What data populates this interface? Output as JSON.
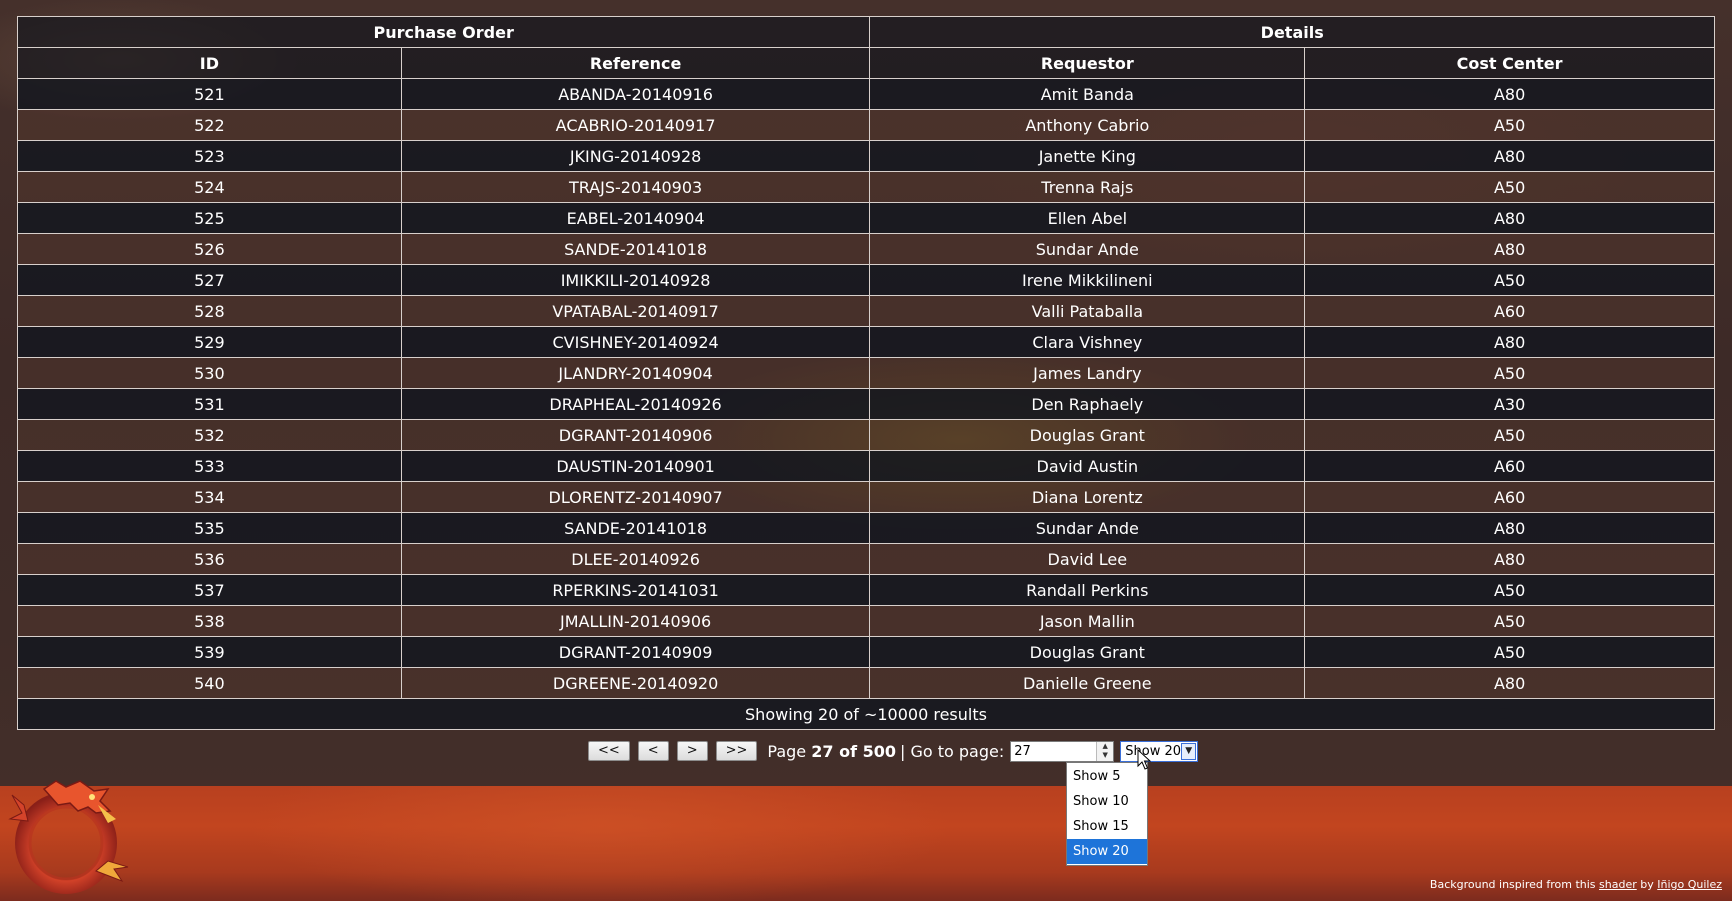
{
  "table": {
    "group_headers": {
      "purchase_order": "Purchase Order",
      "details": "Details"
    },
    "columns": [
      "ID",
      "Reference",
      "Requestor",
      "Cost Center"
    ],
    "rows": [
      [
        "521",
        "ABANDA-20140916",
        "Amit Banda",
        "A80"
      ],
      [
        "522",
        "ACABRIO-20140917",
        "Anthony Cabrio",
        "A50"
      ],
      [
        "523",
        "JKING-20140928",
        "Janette King",
        "A80"
      ],
      [
        "524",
        "TRAJS-20140903",
        "Trenna Rajs",
        "A50"
      ],
      [
        "525",
        "EABEL-20140904",
        "Ellen Abel",
        "A80"
      ],
      [
        "526",
        "SANDE-20141018",
        "Sundar Ande",
        "A80"
      ],
      [
        "527",
        "IMIKKILI-20140928",
        "Irene Mikkilineni",
        "A50"
      ],
      [
        "528",
        "VPATABAL-20140917",
        "Valli Pataballa",
        "A60"
      ],
      [
        "529",
        "CVISHNEY-20140924",
        "Clara Vishney",
        "A80"
      ],
      [
        "530",
        "JLANDRY-20140904",
        "James Landry",
        "A50"
      ],
      [
        "531",
        "DRAPHEAL-20140926",
        "Den Raphaely",
        "A30"
      ],
      [
        "532",
        "DGRANT-20140906",
        "Douglas Grant",
        "A50"
      ],
      [
        "533",
        "DAUSTIN-20140901",
        "David Austin",
        "A60"
      ],
      [
        "534",
        "DLORENTZ-20140907",
        "Diana Lorentz",
        "A60"
      ],
      [
        "535",
        "SANDE-20141018",
        "Sundar Ande",
        "A80"
      ],
      [
        "536",
        "DLEE-20140926",
        "David Lee",
        "A80"
      ],
      [
        "537",
        "RPERKINS-20141031",
        "Randall Perkins",
        "A50"
      ],
      [
        "538",
        "JMALLIN-20140906",
        "Jason Mallin",
        "A50"
      ],
      [
        "539",
        "DGRANT-20140909",
        "Douglas Grant",
        "A50"
      ],
      [
        "540",
        "DGREENE-20140920",
        "Danielle Greene",
        "A80"
      ]
    ],
    "footer": "Showing 20 of ~10000 results"
  },
  "pager": {
    "first_label": "<<",
    "prev_label": "<",
    "next_label": ">",
    "last_label": ">>",
    "page_prefix": "Page ",
    "page_bold": "27 of 500",
    "goto_label": "| Go to page:",
    "goto_value": "27",
    "show_selected": "Show 20",
    "show_options": [
      "Show 5",
      "Show 10",
      "Show 15",
      "Show 20"
    ],
    "selected_index": 3
  },
  "footer_credit": {
    "prefix": "Background inspired from this ",
    "shader_link": "shader",
    "by": " by ",
    "author_link": "Iñigo Quilez"
  },
  "icons": {
    "logo": "dragon-logo-icon",
    "spin": "spinner-arrows-icon",
    "dropdown": "chevron-down-icon",
    "cursor": "mouse-pointer-icon"
  },
  "colors": {
    "accent": "#1e74d9",
    "band": "#c2451f"
  }
}
